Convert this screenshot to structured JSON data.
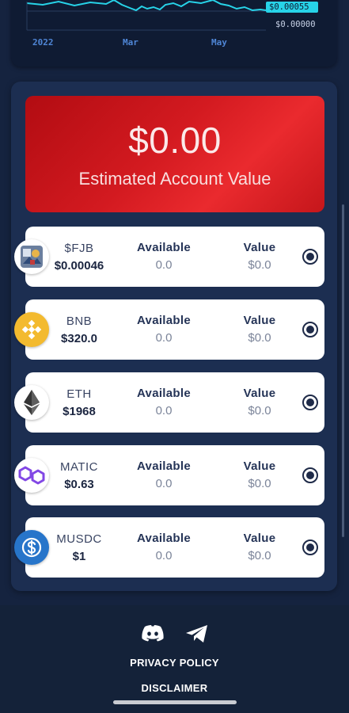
{
  "chart": {
    "current_price_tag": "$0.00055",
    "zero_price_tag": "$0.00000",
    "x_labels": [
      "2022",
      "Mar",
      "May"
    ],
    "line_color": "#27d3e8"
  },
  "account": {
    "value": "$0.00",
    "label": "Estimated Account Value",
    "card_color": "#d31a20"
  },
  "tokens": [
    {
      "symbol": "$FJB",
      "price": "$0.00046",
      "available_header": "Available",
      "available": "0.0",
      "value_header": "Value",
      "value": "$0.0",
      "icon": "fjb-logo-icon",
      "selected": true
    },
    {
      "symbol": "BNB",
      "price": "$320.0",
      "available_header": "Available",
      "available": "0.0",
      "value_header": "Value",
      "value": "$0.0",
      "icon": "bnb-icon",
      "selected": true
    },
    {
      "symbol": "ETH",
      "price": "$1968",
      "available_header": "Available",
      "available": "0.0",
      "value_header": "Value",
      "value": "$0.0",
      "icon": "eth-icon",
      "selected": true
    },
    {
      "symbol": "MATIC",
      "price": "$0.63",
      "available_header": "Available",
      "available": "0.0",
      "value_header": "Value",
      "value": "$0.0",
      "icon": "matic-icon",
      "selected": true
    },
    {
      "symbol": "MUSDC",
      "price": "$1",
      "available_header": "Available",
      "available": "0.0",
      "value_header": "Value",
      "value": "$0.0",
      "icon": "usdc-icon",
      "selected": true
    }
  ],
  "footer": {
    "social_icons": [
      "discord-icon",
      "telegram-icon"
    ],
    "privacy_policy": "PRIVACY POLICY",
    "disclaimer": "DISCLAIMER"
  }
}
